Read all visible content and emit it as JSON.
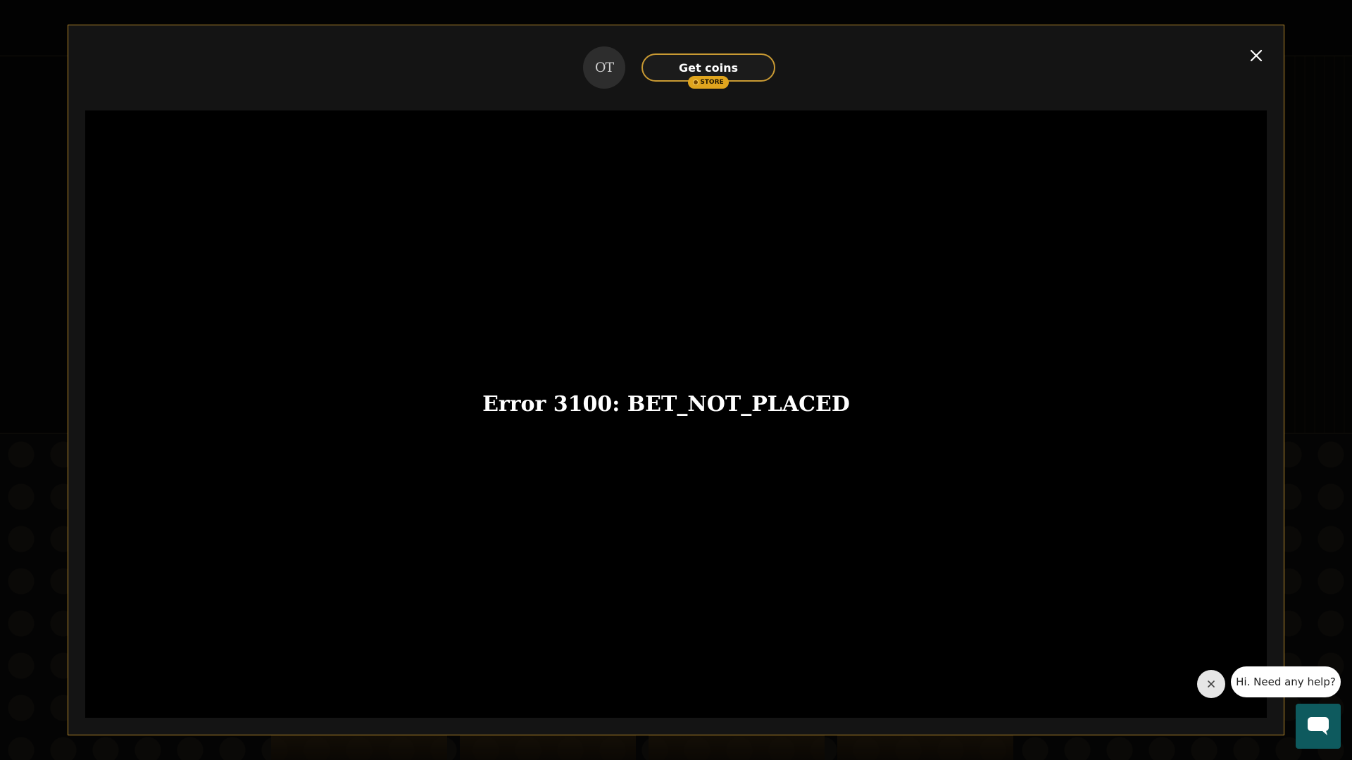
{
  "modal": {
    "avatar_initials": "OT",
    "get_coins_label": "Get coins",
    "store_badge_label": "STORE",
    "error_message": "Error 3100: BET_NOT_PLACED",
    "border_color": "#b8892a"
  },
  "chat": {
    "greeting": "Hi. Need any help?",
    "launcher_color": "#0e5a5e"
  },
  "icons": {
    "close": "close-icon",
    "chat": "chat-icon",
    "coin": "coin-icon"
  }
}
